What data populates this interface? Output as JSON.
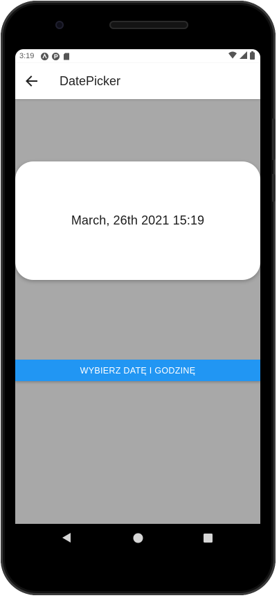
{
  "status_bar": {
    "time": "3:19",
    "left_icons": [
      "notification-a-icon",
      "notification-p-icon",
      "sd-card-icon"
    ],
    "right_icons": [
      "wifi-icon",
      "cell-signal-icon",
      "battery-icon"
    ]
  },
  "app_bar": {
    "title": "DatePicker",
    "back_icon": "arrow-back-icon"
  },
  "date_card": {
    "text": "March, 26th 2021 15:19"
  },
  "pick_button": {
    "label": "WYBIERZ DATĘ I GODZINĘ",
    "color": "#2196f3"
  },
  "nav_bar": {
    "icons": [
      "back-triangle-icon",
      "home-circle-icon",
      "recents-square-icon"
    ]
  },
  "colors": {
    "screen_background": "#a8a8a8",
    "card_background": "#ffffff",
    "accent": "#2196f3"
  }
}
